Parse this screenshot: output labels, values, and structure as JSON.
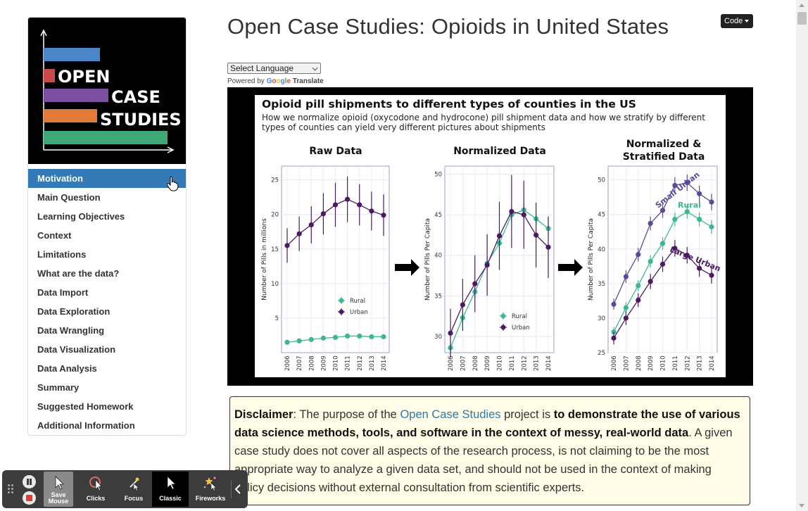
{
  "page": {
    "title": "Open Case Studies: Opioids in United States",
    "code_button": "Code"
  },
  "logo": {
    "words": [
      "OPEN",
      "CASE",
      "STUDIES"
    ],
    "bar_colors": [
      "#4a86c8",
      "#c94a4a",
      "#7b4fa0",
      "#e07b39",
      "#3fa877"
    ]
  },
  "toc": {
    "items": [
      {
        "label": "Motivation",
        "active": true
      },
      {
        "label": "Main Question"
      },
      {
        "label": "Learning Objectives"
      },
      {
        "label": "Context"
      },
      {
        "label": "Limitations"
      },
      {
        "label": "What are the data?"
      },
      {
        "label": "Data Import"
      },
      {
        "label": "Data Exploration"
      },
      {
        "label": "Data Wrangling"
      },
      {
        "label": "Data Visualization"
      },
      {
        "label": "Data Analysis"
      },
      {
        "label": "Summary"
      },
      {
        "label": "Suggested Homework"
      },
      {
        "label": "Additional Information"
      }
    ]
  },
  "translate": {
    "select_value": "Select Language",
    "powered_by": "Powered by",
    "google": [
      "G",
      "o",
      "o",
      "g",
      "l",
      "e"
    ],
    "translate_link": "Translate"
  },
  "figure": {
    "title": "Opioid pill shipments to different types of counties in the US",
    "subtitle_line1": "How we normalize opioid (oxycodone and hydrocone) pill shipment data and how we stratify by different",
    "subtitle_line2": "types of counties can yield very different pictures about shipments",
    "colors": {
      "rural": "#3bb891",
      "urban": "#4a1a63",
      "small_urban": "#5b4a9a",
      "panel_bg": "#ffffff",
      "border": "#9c9cc8"
    }
  },
  "chart_data": [
    {
      "type": "line",
      "title": "Raw Data",
      "ylabel": "Number of Pills in millions",
      "x": [
        2006,
        2007,
        2008,
        2009,
        2010,
        2011,
        2012,
        2013,
        2014
      ],
      "ylim": [
        0,
        27
      ],
      "yticks": [
        5,
        10,
        15,
        20,
        25
      ],
      "legend_position": "bottom-right",
      "series": [
        {
          "name": "Rural",
          "values": [
            1.5,
            1.7,
            1.9,
            2.1,
            2.2,
            2.4,
            2.4,
            2.3,
            2.3
          ],
          "err": [
            0.3,
            0.3,
            0.3,
            0.3,
            0.3,
            0.3,
            0.3,
            0.3,
            0.3
          ]
        },
        {
          "name": "Urban",
          "values": [
            15.5,
            17.2,
            18.5,
            20.1,
            21.4,
            22.2,
            21.4,
            20.5,
            19.9
          ],
          "err": [
            2.5,
            2.5,
            2.7,
            3.0,
            3.2,
            3.3,
            3.0,
            2.8,
            3.0
          ]
        }
      ]
    },
    {
      "type": "line",
      "title": "Normalized Data",
      "ylabel": "Number of Pills Per Capita",
      "x": [
        2006,
        2007,
        2008,
        2009,
        2010,
        2011,
        2012,
        2013,
        2014
      ],
      "ylim": [
        28,
        51
      ],
      "yticks": [
        30,
        35,
        40,
        45,
        50
      ],
      "legend_position": "bottom-right",
      "series": [
        {
          "name": "Rural",
          "values": [
            28.6,
            32.3,
            35.5,
            39.0,
            41.5,
            45.0,
            45.6,
            44.5,
            43.3
          ],
          "err": [
            0.8,
            0.8,
            0.8,
            0.9,
            0.9,
            1.0,
            1.0,
            1.0,
            1.0
          ]
        },
        {
          "name": "Urban",
          "values": [
            30.4,
            33.9,
            36.5,
            38.8,
            42.4,
            45.4,
            45.0,
            42.5,
            41.0
          ],
          "err": [
            3.0,
            3.2,
            3.5,
            3.8,
            4.2,
            4.5,
            4.2,
            4.0,
            3.8
          ]
        }
      ]
    },
    {
      "type": "line",
      "title": "Normalized & Stratified Data",
      "ylabel": "Number of Pills Per Capita",
      "x": [
        2006,
        2007,
        2008,
        2009,
        2010,
        2011,
        2012,
        2013,
        2014
      ],
      "ylim": [
        25,
        52
      ],
      "yticks": [
        25,
        30,
        35,
        40,
        45,
        50
      ],
      "series": [
        {
          "name": "Small Urban",
          "values": [
            32.0,
            36.0,
            39.2,
            43.7,
            45.6,
            49.2,
            49.6,
            48.0,
            46.8
          ],
          "err": [
            0.8,
            0.9,
            1.0,
            1.0,
            1.1,
            1.2,
            1.2,
            1.2,
            1.2
          ]
        },
        {
          "name": "Rural",
          "values": [
            28.0,
            31.5,
            34.7,
            38.2,
            40.8,
            44.3,
            45.4,
            44.3,
            43.2
          ],
          "err": [
            0.7,
            0.8,
            0.8,
            0.9,
            0.9,
            1.0,
            1.0,
            1.0,
            1.0
          ]
        },
        {
          "name": "Large Urban",
          "values": [
            27.1,
            30.0,
            32.6,
            35.3,
            37.8,
            40.1,
            39.1,
            37.2,
            36.2
          ],
          "err": [
            0.9,
            1.0,
            1.0,
            1.1,
            1.1,
            1.2,
            1.2,
            1.2,
            1.2
          ]
        }
      ]
    }
  ],
  "disclaimer": {
    "label": "Disclaimer",
    "t1": ": The purpose of the ",
    "link": "Open Case Studies",
    "t2": " project is ",
    "bold": "to demonstrate the use of various data science methods, tools, and software in the context of messy, real-world data",
    "t3": ". A given case study does not cover all aspects of the research process, is not claiming to be the most appropriate way to analyze a given data set, and should not be used in the context of making policy decisions without external consultation from scientific experts."
  },
  "recorder": {
    "tools": [
      {
        "label1": "Save",
        "label2": "Mouse",
        "icon": "mouse-pointer-icon",
        "state": "gray"
      },
      {
        "label1": "Clicks",
        "label2": "",
        "icon": "click-ring-icon",
        "state": "none"
      },
      {
        "label1": "Focus",
        "label2": "",
        "icon": "focus-wand-icon",
        "state": "none"
      },
      {
        "label1": "Classic",
        "label2": "",
        "icon": "arrow-pointer-icon",
        "state": "black"
      },
      {
        "label1": "Fireworks",
        "label2": "",
        "icon": "fireworks-icon",
        "state": "none"
      }
    ]
  }
}
